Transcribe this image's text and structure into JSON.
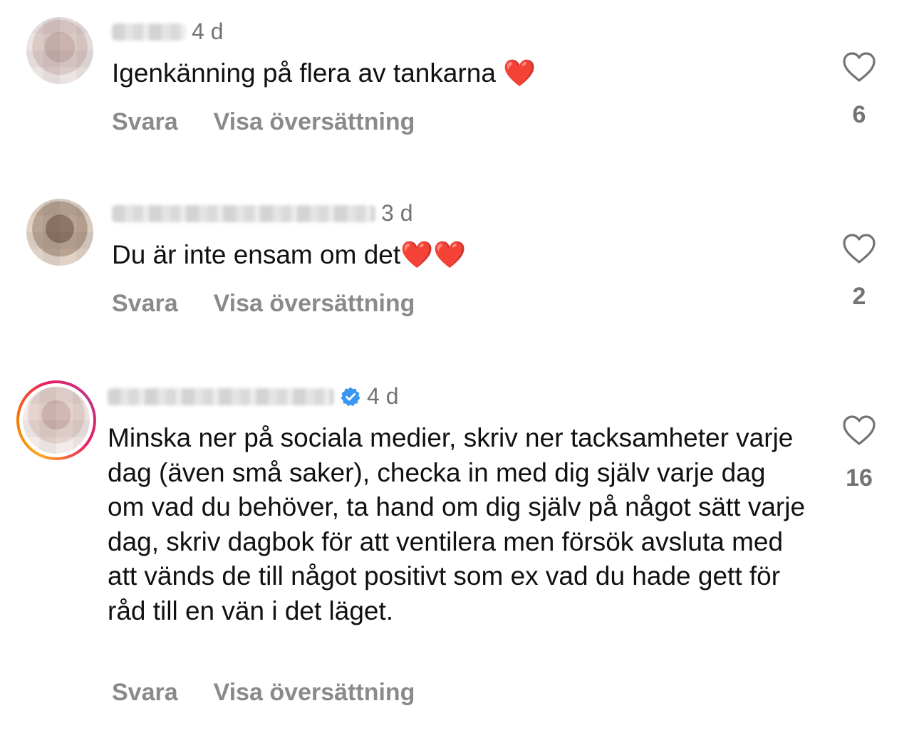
{
  "comments": [
    {
      "username": "",
      "verified": false,
      "time": "4 d",
      "text": "Igenkänning på flera av tankarna ❤️",
      "reply_label": "Svara",
      "translate_label": "Visa översättning",
      "likes": "6",
      "avatar_colors": [
        "#d9c9c6",
        "#c9b4b0",
        "#e9e1e0"
      ]
    },
    {
      "username": "",
      "verified": false,
      "time": "3 d",
      "text": "Du är inte ensam om det❤️❤️",
      "reply_label": "Svara",
      "translate_label": "Visa översättning",
      "likes": "2",
      "avatar_colors": [
        "#b9a393",
        "#8e7566",
        "#d8c6b8"
      ]
    },
    {
      "username": "",
      "verified": true,
      "time": "4 d",
      "text": "Minska ner på sociala medier, skriv ner tacksamheter varje dag (även små saker), checka in med dig själv varje dag om vad du behöver, ta hand om dig själv på något sätt varje dag, skriv dagbok för att ventilera men försök avsluta med att vänds de till något positivt som ex vad du hade gett för råd till en vän i det läget.",
      "reply_label": "Svara",
      "translate_label": "Visa översättning",
      "likes": "16",
      "avatar_colors": [
        "#e6d3cf",
        "#d2b8b4",
        "#f1e7e4"
      ],
      "story_ring": true
    }
  ],
  "icons": {
    "like": "heart-outline-icon",
    "verified": "verified-badge-icon",
    "verified_color": "#3897f0"
  }
}
